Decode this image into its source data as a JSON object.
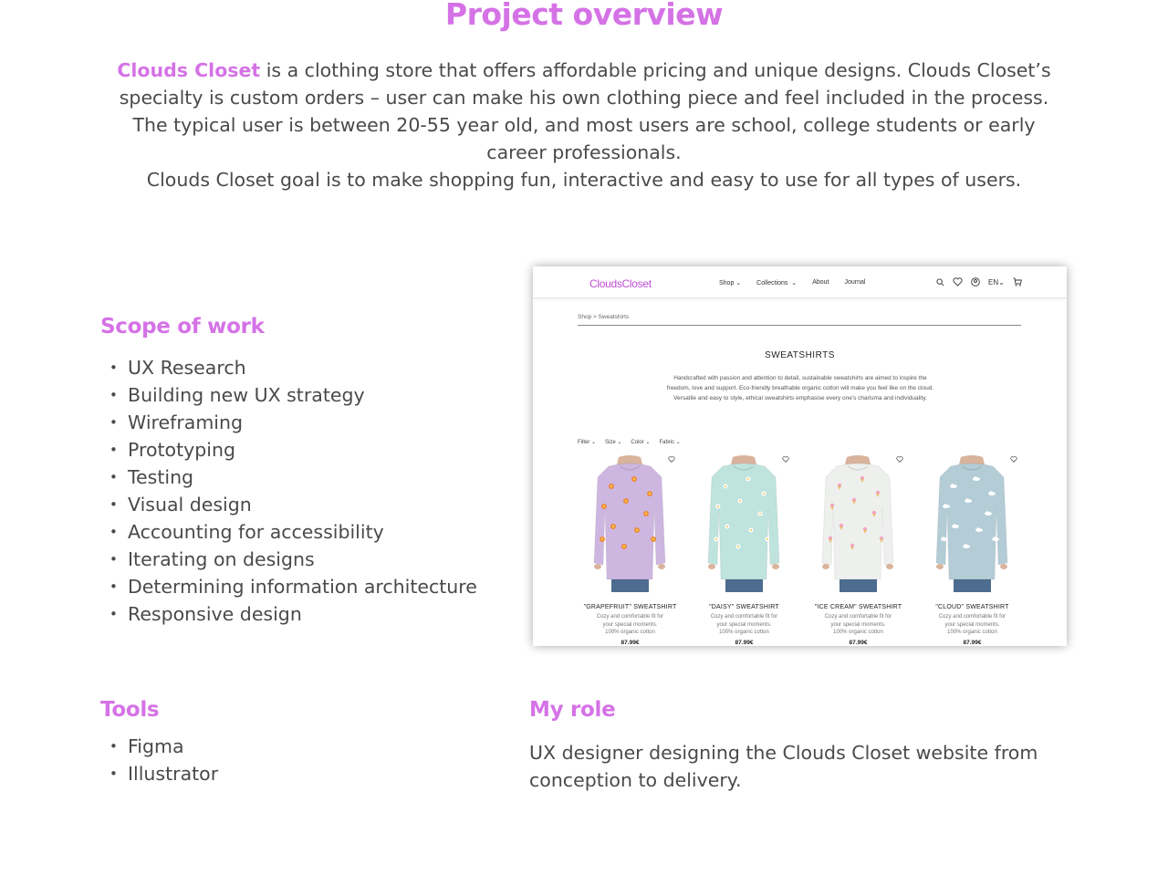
{
  "page_title": "Project overview",
  "intro": {
    "brand": "Clouds Closet",
    "text1": " is a clothing store that offers affordable pricing and unique designs. Clouds Closet’s specialty is custom orders – user can make his own clothing piece and feel included in the process. The typical user is between 20-55 year old, and most users are school, college students or early career professionals.",
    "text2": "Clouds Closet goal is to make shopping fun, interactive and easy to use for all types of users."
  },
  "scope": {
    "heading": "Scope of work",
    "items": [
      "UX Research",
      "Building new UX strategy",
      "Wireframing",
      "Prototyping",
      "Testing",
      "Visual design",
      "Accounting for accessibility",
      "Iterating on designs",
      "Determining information architecture",
      "Responsive design"
    ]
  },
  "tools": {
    "heading": "Tools",
    "items": [
      "Figma",
      "Illustrator"
    ]
  },
  "role": {
    "heading": "My role",
    "text": "UX designer designing the Clouds Closet website from conception to delivery."
  },
  "mockup": {
    "logo": "CloudsCloset",
    "nav": [
      "Shop",
      "Collections",
      "About",
      "Journal"
    ],
    "language": "EN",
    "breadcrumb": "Shop > Sweatshirts",
    "heading": "SWEATSHIRTS",
    "description": "Handcrafted with passion and attention to detail, sustainable sweatshirts are aimed to inspire the freedom, love and support. Eco-friendly breathable organic cotton will make you feel like on the cloud. Versatile and easy to style, ethical sweatshirts emphasise every one's charisma and individuality.",
    "filters": [
      "Filter",
      "Size",
      "Color",
      "Fabric"
    ],
    "products": [
      {
        "name": "\"GRAPEFRUIT\" SWEATSHIRT",
        "desc1": "Cozy and comfortable fit for",
        "desc2": "your special moments.",
        "desc3": "100% organic cotton",
        "price": "87.99€",
        "color": "#cdb6e0",
        "icon": "flower-pattern"
      },
      {
        "name": "\"DAISY\" SWEATSHIRT",
        "desc1": "Cozy and comfortable fit for",
        "desc2": "your special moments.",
        "desc3": "100% organic cotton",
        "price": "87.99€",
        "color": "#bfe3dd",
        "icon": "daisy-pattern"
      },
      {
        "name": "\"ICE CREAM\" SWEATSHIRT",
        "desc1": "Cozy and comfortable fit for",
        "desc2": "your special moments.",
        "desc3": "100% organic cotton",
        "price": "87.99€",
        "color": "#eef0ee",
        "icon": "ice-cream-pattern"
      },
      {
        "name": "\"CLOUD\" SWEATSHIRT",
        "desc1": "Cozy and comfortable fit for",
        "desc2": "your special moments.",
        "desc3": "100% organic cotton",
        "price": "87.99€",
        "color": "#b3ccd6",
        "icon": "cloud-pattern"
      }
    ]
  },
  "colors": {
    "accent": "#d572e6",
    "text": "#4a4a4a"
  }
}
